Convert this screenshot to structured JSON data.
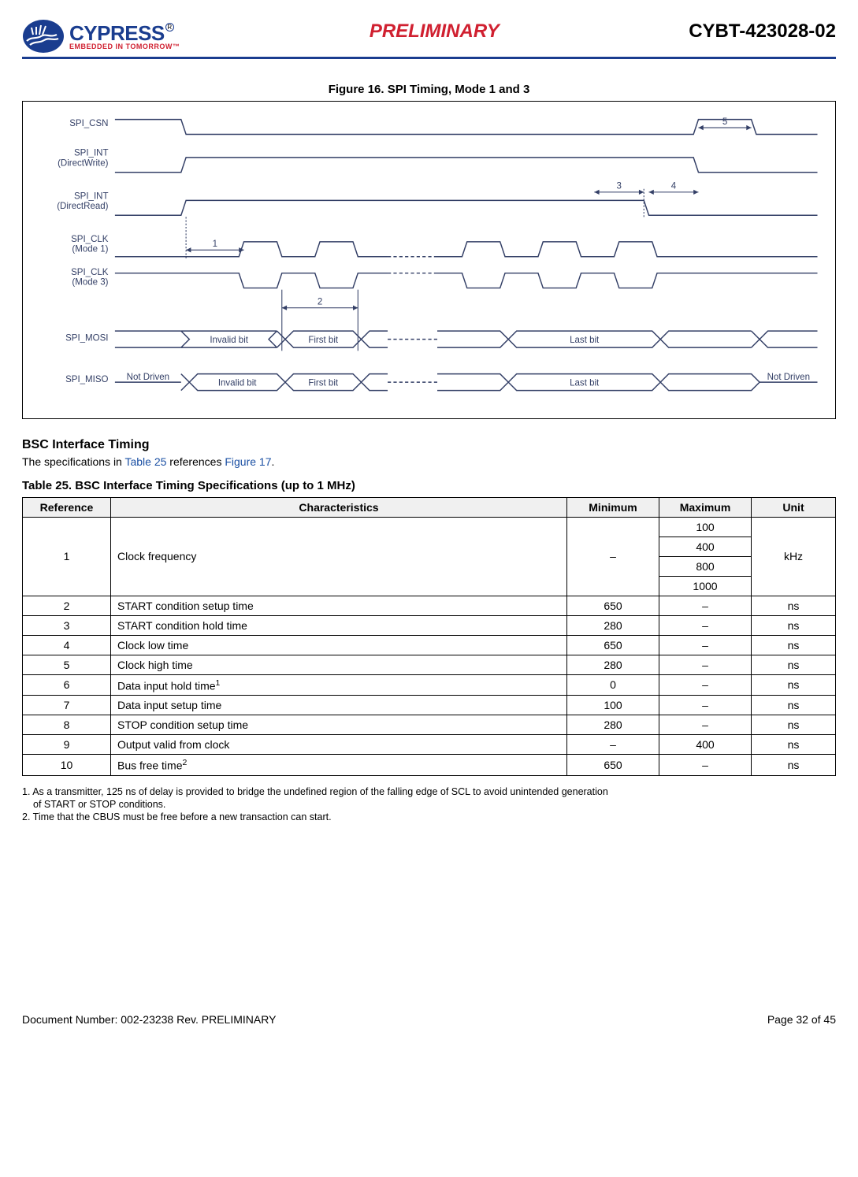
{
  "header": {
    "brand": "CYPRESS",
    "tagline": "EMBEDDED IN TOMORROW™",
    "preliminary": "PRELIMINARY",
    "part_number": "CYBT-423028-02"
  },
  "figure16": {
    "title": "Figure 16.  SPI Timing, Mode 1 and 3",
    "signals": {
      "csn": "SPI_CSN",
      "int_dw": "SPI_INT\n(DirectWrite)",
      "int_dr": "SPI_INT\n(DirectRead)",
      "clk1": "SPI_CLK\n(Mode 1)",
      "clk3": "SPI_CLK\n(Mode 3)",
      "mosi": "SPI_MOSI",
      "miso": "SPI_MISO"
    },
    "labels": {
      "invalid": "Invalid bit",
      "first": "First bit",
      "last": "Last bit",
      "notdriven": "Not Driven"
    },
    "marks": {
      "m1": "1",
      "m2": "2",
      "m3": "3",
      "m4": "4",
      "m5": "5"
    }
  },
  "section_heading": "BSC Interface Timing",
  "section_text_a": "The specifications in ",
  "section_link1": "Table 25",
  "section_text_b": " references ",
  "section_link2": "Figure 17",
  "section_text_c": ".",
  "table25": {
    "caption": "Table 25.  BSC Interface Timing Specifications (up to 1 MHz)",
    "headers": {
      "ref": "Reference",
      "char": "Characteristics",
      "min": "Minimum",
      "max": "Maximum",
      "unit": "Unit"
    },
    "row1": {
      "ref": "1",
      "char": "Clock frequency",
      "min": "–",
      "max1": "100",
      "max2": "400",
      "max3": "800",
      "max4": "1000",
      "unit": "kHz"
    },
    "rows": [
      {
        "ref": "2",
        "char": "START condition setup time",
        "min": "650",
        "max": "–",
        "unit": "ns"
      },
      {
        "ref": "3",
        "char": "START condition hold time",
        "min": "280",
        "max": "–",
        "unit": "ns"
      },
      {
        "ref": "4",
        "char": "Clock low time",
        "min": "650",
        "max": "–",
        "unit": "ns"
      },
      {
        "ref": "5",
        "char": "Clock high time",
        "min": "280",
        "max": "–",
        "unit": "ns"
      },
      {
        "ref": "6",
        "char": "Data input hold time",
        "sup": "1",
        "min": "0",
        "max": "–",
        "unit": "ns"
      },
      {
        "ref": "7",
        "char": "Data input setup time",
        "min": "100",
        "max": "–",
        "unit": "ns"
      },
      {
        "ref": "8",
        "char": "STOP condition setup time",
        "min": "280",
        "max": "–",
        "unit": "ns"
      },
      {
        "ref": "9",
        "char": "Output valid from clock",
        "min": "–",
        "max": "400",
        "unit": "ns"
      },
      {
        "ref": "10",
        "char": "Bus free time",
        "sup": "2",
        "min": "650",
        "max": "–",
        "unit": "ns"
      }
    ]
  },
  "notes": {
    "n1a": "1. As a transmitter, 125 ns of delay is provided to bridge the undefined region of the falling edge of SCL to avoid unintended generation",
    "n1b": "of START or STOP conditions.",
    "n2": "2. Time that the CBUS must be free before a new transaction can start."
  },
  "footer": {
    "docnum": "Document Number: 002-23238 Rev. PRELIMINARY",
    "page": "Page 32 of 45"
  }
}
